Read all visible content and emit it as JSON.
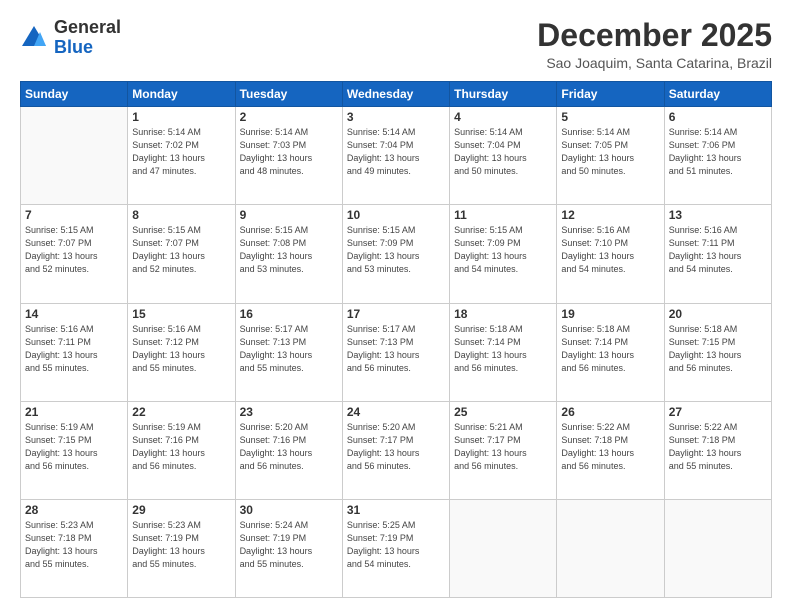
{
  "logo": {
    "general": "General",
    "blue": "Blue"
  },
  "header": {
    "month": "December 2025",
    "location": "Sao Joaquim, Santa Catarina, Brazil"
  },
  "days_of_week": [
    "Sunday",
    "Monday",
    "Tuesday",
    "Wednesday",
    "Thursday",
    "Friday",
    "Saturday"
  ],
  "weeks": [
    [
      {
        "day": "",
        "info": ""
      },
      {
        "day": "1",
        "info": "Sunrise: 5:14 AM\nSunset: 7:02 PM\nDaylight: 13 hours\nand 47 minutes."
      },
      {
        "day": "2",
        "info": "Sunrise: 5:14 AM\nSunset: 7:03 PM\nDaylight: 13 hours\nand 48 minutes."
      },
      {
        "day": "3",
        "info": "Sunrise: 5:14 AM\nSunset: 7:04 PM\nDaylight: 13 hours\nand 49 minutes."
      },
      {
        "day": "4",
        "info": "Sunrise: 5:14 AM\nSunset: 7:04 PM\nDaylight: 13 hours\nand 50 minutes."
      },
      {
        "day": "5",
        "info": "Sunrise: 5:14 AM\nSunset: 7:05 PM\nDaylight: 13 hours\nand 50 minutes."
      },
      {
        "day": "6",
        "info": "Sunrise: 5:14 AM\nSunset: 7:06 PM\nDaylight: 13 hours\nand 51 minutes."
      }
    ],
    [
      {
        "day": "7",
        "info": "Sunrise: 5:15 AM\nSunset: 7:07 PM\nDaylight: 13 hours\nand 52 minutes."
      },
      {
        "day": "8",
        "info": "Sunrise: 5:15 AM\nSunset: 7:07 PM\nDaylight: 13 hours\nand 52 minutes."
      },
      {
        "day": "9",
        "info": "Sunrise: 5:15 AM\nSunset: 7:08 PM\nDaylight: 13 hours\nand 53 minutes."
      },
      {
        "day": "10",
        "info": "Sunrise: 5:15 AM\nSunset: 7:09 PM\nDaylight: 13 hours\nand 53 minutes."
      },
      {
        "day": "11",
        "info": "Sunrise: 5:15 AM\nSunset: 7:09 PM\nDaylight: 13 hours\nand 54 minutes."
      },
      {
        "day": "12",
        "info": "Sunrise: 5:16 AM\nSunset: 7:10 PM\nDaylight: 13 hours\nand 54 minutes."
      },
      {
        "day": "13",
        "info": "Sunrise: 5:16 AM\nSunset: 7:11 PM\nDaylight: 13 hours\nand 54 minutes."
      }
    ],
    [
      {
        "day": "14",
        "info": "Sunrise: 5:16 AM\nSunset: 7:11 PM\nDaylight: 13 hours\nand 55 minutes."
      },
      {
        "day": "15",
        "info": "Sunrise: 5:16 AM\nSunset: 7:12 PM\nDaylight: 13 hours\nand 55 minutes."
      },
      {
        "day": "16",
        "info": "Sunrise: 5:17 AM\nSunset: 7:13 PM\nDaylight: 13 hours\nand 55 minutes."
      },
      {
        "day": "17",
        "info": "Sunrise: 5:17 AM\nSunset: 7:13 PM\nDaylight: 13 hours\nand 56 minutes."
      },
      {
        "day": "18",
        "info": "Sunrise: 5:18 AM\nSunset: 7:14 PM\nDaylight: 13 hours\nand 56 minutes."
      },
      {
        "day": "19",
        "info": "Sunrise: 5:18 AM\nSunset: 7:14 PM\nDaylight: 13 hours\nand 56 minutes."
      },
      {
        "day": "20",
        "info": "Sunrise: 5:18 AM\nSunset: 7:15 PM\nDaylight: 13 hours\nand 56 minutes."
      }
    ],
    [
      {
        "day": "21",
        "info": "Sunrise: 5:19 AM\nSunset: 7:15 PM\nDaylight: 13 hours\nand 56 minutes."
      },
      {
        "day": "22",
        "info": "Sunrise: 5:19 AM\nSunset: 7:16 PM\nDaylight: 13 hours\nand 56 minutes."
      },
      {
        "day": "23",
        "info": "Sunrise: 5:20 AM\nSunset: 7:16 PM\nDaylight: 13 hours\nand 56 minutes."
      },
      {
        "day": "24",
        "info": "Sunrise: 5:20 AM\nSunset: 7:17 PM\nDaylight: 13 hours\nand 56 minutes."
      },
      {
        "day": "25",
        "info": "Sunrise: 5:21 AM\nSunset: 7:17 PM\nDaylight: 13 hours\nand 56 minutes."
      },
      {
        "day": "26",
        "info": "Sunrise: 5:22 AM\nSunset: 7:18 PM\nDaylight: 13 hours\nand 56 minutes."
      },
      {
        "day": "27",
        "info": "Sunrise: 5:22 AM\nSunset: 7:18 PM\nDaylight: 13 hours\nand 55 minutes."
      }
    ],
    [
      {
        "day": "28",
        "info": "Sunrise: 5:23 AM\nSunset: 7:18 PM\nDaylight: 13 hours\nand 55 minutes."
      },
      {
        "day": "29",
        "info": "Sunrise: 5:23 AM\nSunset: 7:19 PM\nDaylight: 13 hours\nand 55 minutes."
      },
      {
        "day": "30",
        "info": "Sunrise: 5:24 AM\nSunset: 7:19 PM\nDaylight: 13 hours\nand 55 minutes."
      },
      {
        "day": "31",
        "info": "Sunrise: 5:25 AM\nSunset: 7:19 PM\nDaylight: 13 hours\nand 54 minutes."
      },
      {
        "day": "",
        "info": ""
      },
      {
        "day": "",
        "info": ""
      },
      {
        "day": "",
        "info": ""
      }
    ]
  ]
}
